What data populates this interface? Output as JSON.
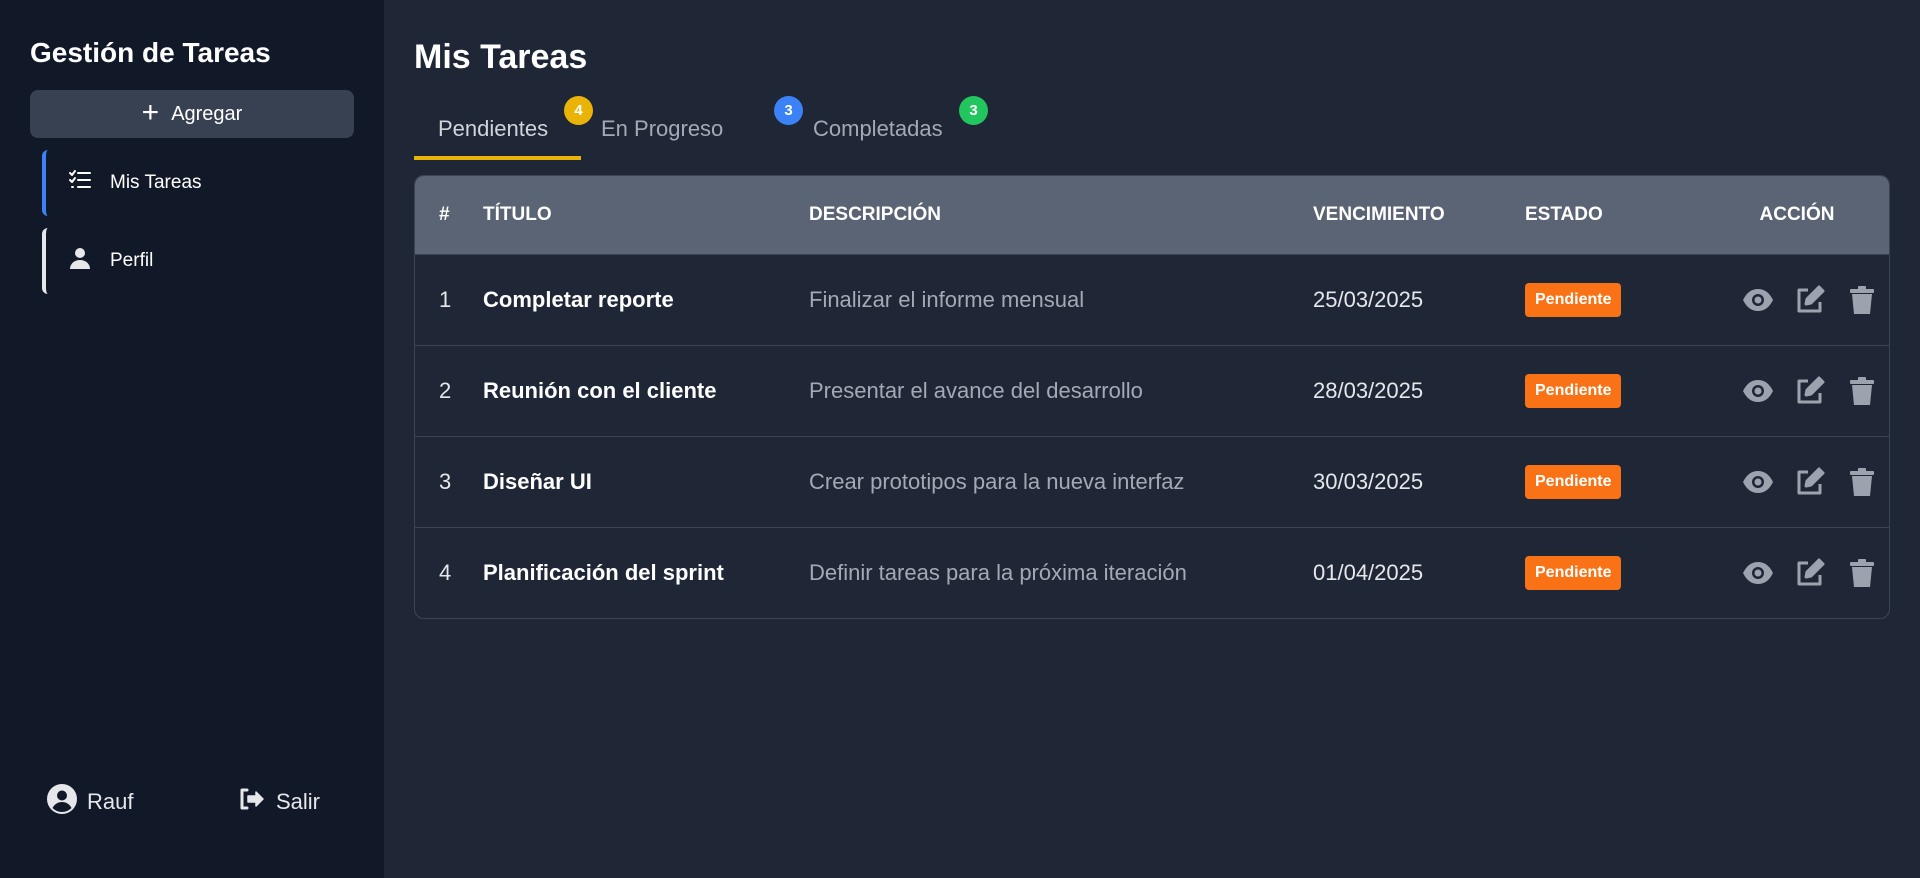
{
  "sidebar": {
    "brand": "Gestión de Tareas",
    "add_label": "Agregar",
    "nav": [
      {
        "label": "Mis Tareas",
        "icon": "list-check-icon",
        "active": true
      },
      {
        "label": "Perfil",
        "icon": "user-icon",
        "active": false
      }
    ],
    "user_name": "Rauf",
    "logout_label": "Salir"
  },
  "main": {
    "title": "Mis Tareas",
    "tabs": [
      {
        "label": "Pendientes",
        "count": "4",
        "color": "#eab308",
        "active": true
      },
      {
        "label": "En Progreso",
        "count": "3",
        "color": "#3b82f6",
        "active": false
      },
      {
        "label": "Completadas",
        "count": "3",
        "color": "#22c55e",
        "active": false
      }
    ],
    "table": {
      "headers": {
        "num": "#",
        "title": "TÍTULO",
        "desc": "DESCRIPCIÓN",
        "due": "VENCIMIENTO",
        "state": "ESTADO",
        "action": "ACCIÓN"
      },
      "rows": [
        {
          "num": "1",
          "title": "Completar reporte",
          "desc": "Finalizar el informe mensual",
          "due": "25/03/2025",
          "state": "Pendiente"
        },
        {
          "num": "2",
          "title": "Reunión con el cliente",
          "desc": "Presentar el avance del desarrollo",
          "due": "28/03/2025",
          "state": "Pendiente"
        },
        {
          "num": "3",
          "title": "Diseñar UI",
          "desc": "Crear prototipos para la nueva interfaz",
          "due": "30/03/2025",
          "state": "Pendiente"
        },
        {
          "num": "4",
          "title": "Planificación del sprint",
          "desc": "Definir tareas para la próxima iteración",
          "due": "01/04/2025",
          "state": "Pendiente"
        }
      ]
    }
  },
  "colors": {
    "accent_active_nav": "#3b82f6",
    "status_pending": "#f97316",
    "tab_underline": "#eab308"
  }
}
